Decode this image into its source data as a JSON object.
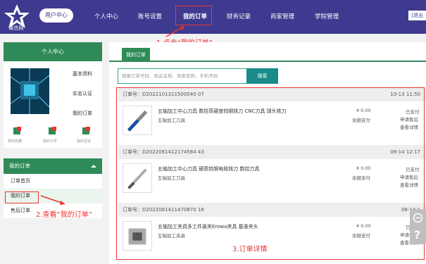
{
  "brand": {
    "logo_text": "某信网"
  },
  "topbar": {
    "user_center": "用户中心",
    "nav": [
      "个人中心",
      "账号设置",
      "我的订单",
      "财务记录",
      "商家管理",
      "学院管理"
    ],
    "logout": "[退出"
  },
  "annotations": {
    "step1": "1.点击“我的订单”",
    "step2": "2.查看“我的订单”",
    "step3": "3.订单详情"
  },
  "left_panel": {
    "title": "个人中心",
    "links": [
      "基本资料",
      "实名认证",
      "我的订单"
    ],
    "quick": [
      "我的收藏",
      "我的订单",
      "我的足迹"
    ]
  },
  "left_menu": {
    "title": "我的订单",
    "items": [
      "订单首页",
      "我的订单",
      "售后订单"
    ]
  },
  "main": {
    "tab": "我的订单",
    "search_placeholder": "搜索订单号码、商品名称、商家名称、手机号码",
    "search_button": "搜索"
  },
  "orders": [
    {
      "order_no": "订单号：D2022101311500540 07",
      "time": "10-13 11:50",
      "name": "五轴加工中心刀具 数控高硬度钨钢铣刀 CNC刀具 球头铣刀",
      "sub": "五轴加工刀具",
      "price": "¥ 0.00",
      "pay": "余额支付",
      "status": [
        "已支付",
        "申请售后",
        "查看详情"
      ]
    },
    {
      "order_no": "订单号：D2022081412174584 43",
      "time": "08-14 12:17",
      "name": "五轴加工中心刀具 硬质钨钢电极铣刀 数控刀具",
      "sub": "五轴加工刀具",
      "price": "¥ 0.00",
      "pay": "余额支付",
      "status": [
        "已支付",
        "申请售后",
        "查看详情"
      ]
    },
    {
      "order_no": "订单号：D2022081411470870 16",
      "time": "08-14 1",
      "name": "五轴加工夹具多工件装夹Erowa夹具 基准夹头",
      "sub": "五轴加工夹具",
      "price": "¥ 0.00",
      "pay": "余额支付",
      "status": [
        "已支付",
        "申请售后",
        "查看详情"
      ]
    }
  ]
}
